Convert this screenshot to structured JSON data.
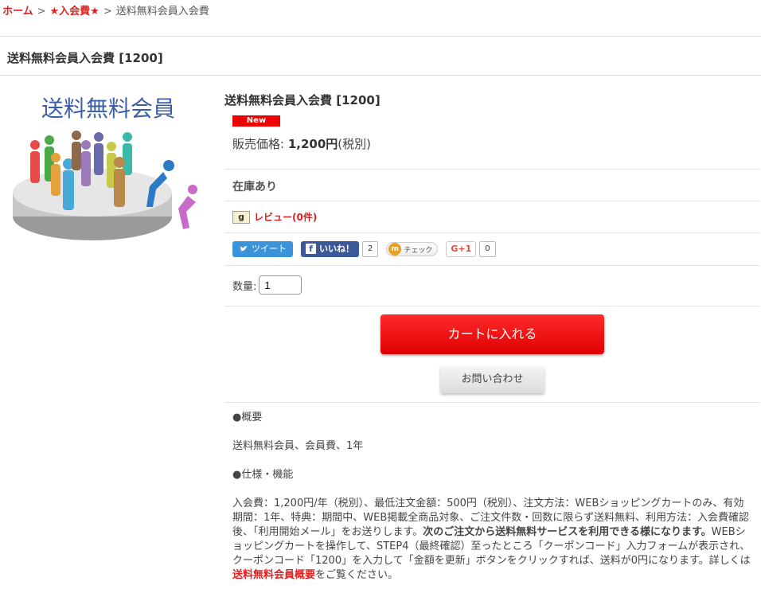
{
  "breadcrumb": {
    "home": "ホーム",
    "category": "★入会費★",
    "current": "送料無料会員入会費",
    "separator": ">"
  },
  "page_title": "送料無料会員入会費 [1200]",
  "image": {
    "caption": "送料無料会員"
  },
  "product": {
    "title": "送料無料会員入会費 [1200]",
    "badge": "New",
    "price_label": "販売価格:",
    "price_value": "1,200円",
    "price_tax": "(税別)",
    "stock": "在庫あり",
    "review": "レビュー(0件)",
    "review_icon": "g"
  },
  "social": {
    "tweet": "ツイート",
    "like": "いいね！",
    "like_count": "2",
    "mixi": "チェック",
    "gplus": "G+1",
    "gplus_count": "0"
  },
  "quantity": {
    "label": "数量:",
    "value": "1"
  },
  "buttons": {
    "cart": "カートに入れる",
    "inquiry": "お問い合わせ"
  },
  "description": {
    "h1": "●概要",
    "summary": "送料無料会員、会員費、1年",
    "h2": "●仕様・機能",
    "body1": "入会費：1,200円/年（税別）、最低注文金額：500円（税別）、注文方法：WEBショッピングカートのみ、有効期間：1年、特典：期間中、WEB掲載全商品対象、ご注文件数・回数に限らず送料無料、利用方法：入会費確認後、「利用開始メール」をお送りします。",
    "body_bold": "次のご注文から送料無料サービスを利用できる様になります。",
    "body2": "WEBショッピングカートを操作して、STEP4（最終確認）至ったところ「クーポンコード」入力フォームが表示され、クーポンコード「1200」を入力して「金額を更新」ボタンをクリックすれば、送料が0円になります。詳しくは",
    "link": "送料無料会員概要",
    "body3": "をご覧ください。"
  },
  "colors": {
    "accent_red": "#e02020",
    "twitter": "#3b94d9",
    "facebook": "#3b5998"
  }
}
